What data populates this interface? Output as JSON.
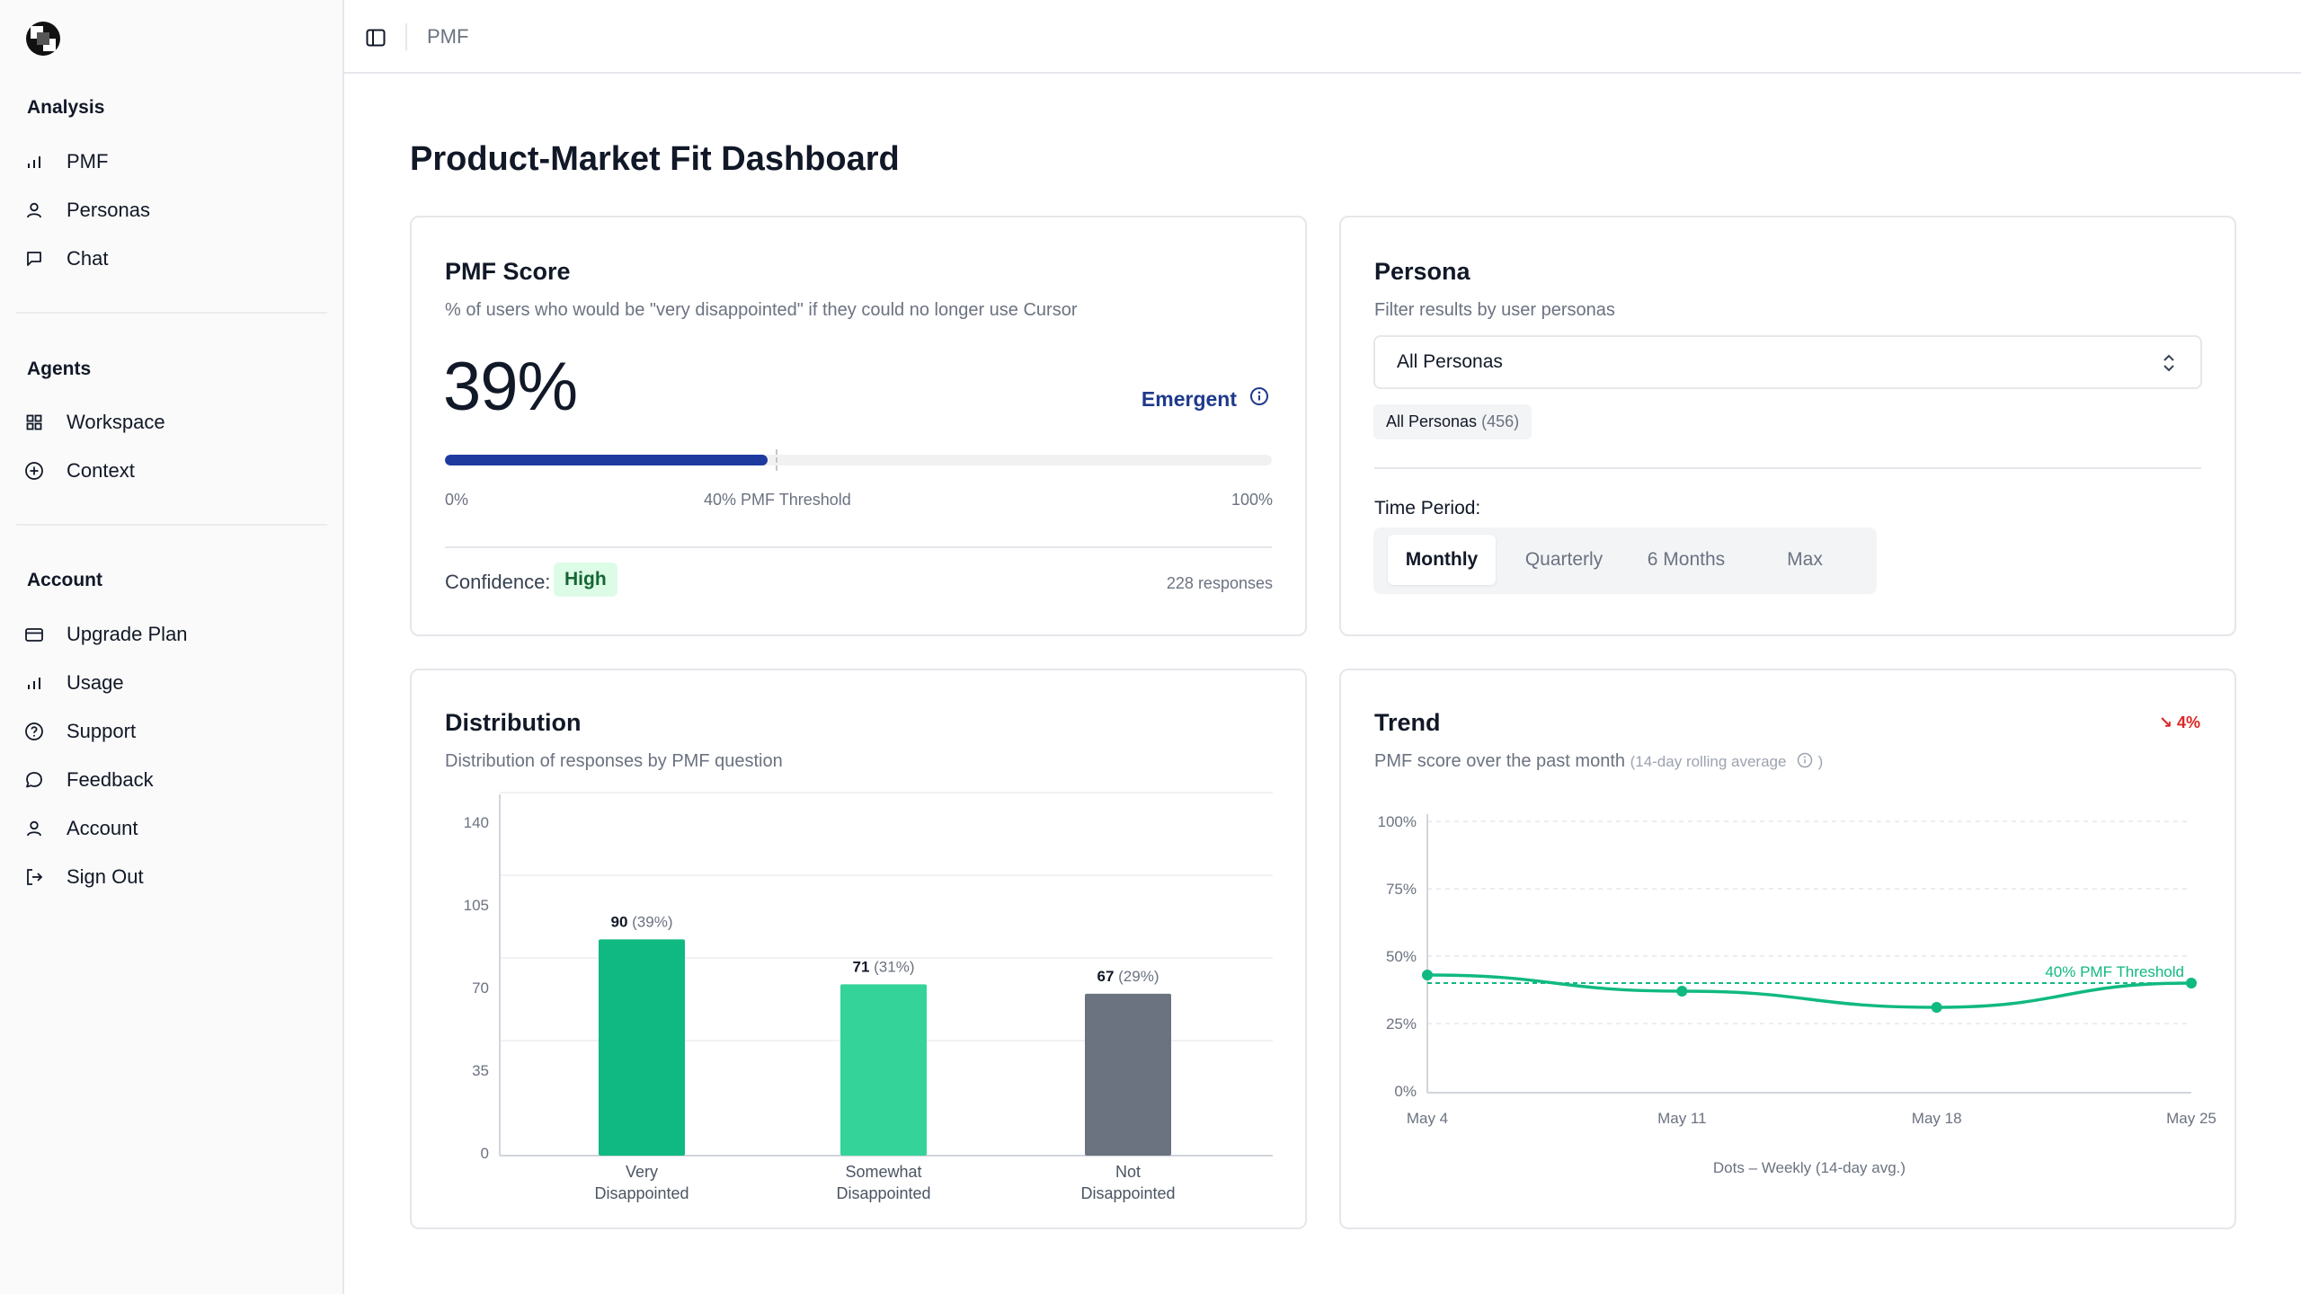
{
  "breadcrumb": "PMF",
  "page_title": "Product-Market Fit Dashboard",
  "sidebar": {
    "sections": [
      {
        "title": "Analysis",
        "items": [
          {
            "label": "PMF",
            "icon": "bar-chart-icon"
          },
          {
            "label": "Personas",
            "icon": "user-icon"
          },
          {
            "label": "Chat",
            "icon": "message-square-icon"
          }
        ]
      },
      {
        "title": "Agents",
        "items": [
          {
            "label": "Workspace",
            "icon": "grid-icon"
          },
          {
            "label": "Context",
            "icon": "plus-circle-icon"
          }
        ]
      },
      {
        "title": "Account",
        "items": [
          {
            "label": "Upgrade Plan",
            "icon": "credit-card-icon"
          },
          {
            "label": "Usage",
            "icon": "bar-chart-icon"
          },
          {
            "label": "Support",
            "icon": "help-circle-icon"
          },
          {
            "label": "Feedback",
            "icon": "message-circle-icon"
          },
          {
            "label": "Account",
            "icon": "user-icon"
          },
          {
            "label": "Sign Out",
            "icon": "log-out-icon"
          }
        ]
      }
    ]
  },
  "pmf_card": {
    "title": "PMF Score",
    "subtitle": "% of users who would be \"very disappointed\" if they could no longer use Cursor",
    "score": "39%",
    "score_value": 39,
    "threshold_value": 40,
    "status": "Emergent",
    "tick_min": "0%",
    "tick_threshold": "40% PMF Threshold",
    "tick_max": "100%",
    "confidence_label": "Confidence:",
    "confidence_value": "High",
    "responses": "228 responses"
  },
  "persona_card": {
    "title": "Persona",
    "subtitle": "Filter results by user personas",
    "select_value": "All Personas",
    "chip_label": "All Personas",
    "chip_count": "(456)",
    "time_period_label": "Time Period:",
    "periods": [
      "Monthly",
      "Quarterly",
      "6 Months",
      "Max"
    ],
    "active_period": "Monthly"
  },
  "distribution_card": {
    "title": "Distribution",
    "subtitle": "Distribution of responses by PMF question"
  },
  "trend_card": {
    "title": "Trend",
    "subtitle": "PMF score over the past month",
    "subtitle_note": "(14-day rolling average",
    "subtitle_note_end": ")",
    "change": "↘ 4%",
    "footer": "Dots – Weekly (14-day avg.)"
  },
  "chart_data": [
    {
      "type": "bar",
      "categories": [
        [
          "Very",
          "Disappointed"
        ],
        [
          "Somewhat",
          "Disappointed"
        ],
        [
          "Not",
          "Disappointed"
        ]
      ],
      "values": [
        90,
        71,
        67
      ],
      "value_labels": [
        "90",
        "71",
        "67"
      ],
      "pct_labels": [
        "(39%)",
        "(31%)",
        "(29%)"
      ],
      "colors": [
        "#10b981",
        "#34d399",
        "#6b7280"
      ],
      "yticks": [
        0,
        35,
        70,
        105,
        140
      ],
      "ylim": [
        0,
        140
      ],
      "grid": true
    },
    {
      "type": "line",
      "x": [
        "May 4",
        "May 11",
        "May 18",
        "May 25"
      ],
      "y": [
        43,
        37,
        31,
        40
      ],
      "yticks": [
        "0%",
        "25%",
        "50%",
        "75%",
        "100%"
      ],
      "ylim": [
        0,
        100
      ],
      "threshold": 40,
      "threshold_label": "40% PMF Threshold",
      "color": "#10b981",
      "grid": true
    }
  ]
}
